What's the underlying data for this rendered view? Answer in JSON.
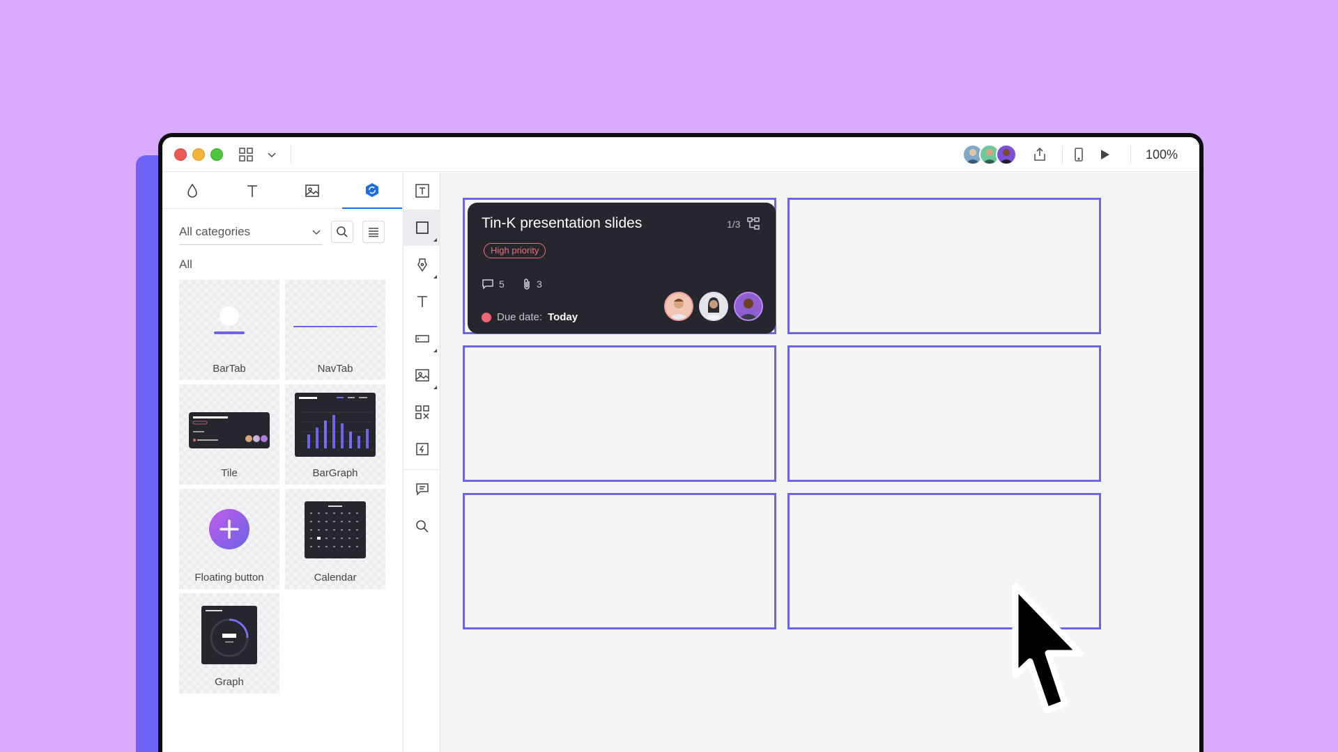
{
  "window": {
    "zoom_label": "100%"
  },
  "left_panel": {
    "tabs": [
      {
        "icon": "drop-icon"
      },
      {
        "icon": "text-icon"
      },
      {
        "icon": "image-icon"
      },
      {
        "icon": "component-icon",
        "active": true
      }
    ],
    "category_select": "All categories",
    "section_title": "All",
    "components": [
      {
        "label": "BarTab"
      },
      {
        "label": "NavTab"
      },
      {
        "label": "Tile"
      },
      {
        "label": "BarGraph"
      },
      {
        "label": "Floating button"
      },
      {
        "label": "Calendar"
      },
      {
        "label": "Graph"
      }
    ]
  },
  "toolbar": {
    "tools": [
      "text-box-icon",
      "rectangle-icon",
      "pen-icon",
      "text-icon",
      "input-field-icon",
      "image-icon",
      "components-icon",
      "interaction-icon",
      "comment-icon",
      "search-icon"
    ]
  },
  "card": {
    "title": "Tin-K presentation slides",
    "page": "1/3",
    "priority": "High priority",
    "comments": "5",
    "attachments": "3",
    "due_label": "Due date:",
    "due_value": "Today"
  },
  "colors": {
    "background": "#d9a9fd",
    "accent": "#6c63e8",
    "card": "#26262e",
    "priority": "#ef6f7c"
  }
}
